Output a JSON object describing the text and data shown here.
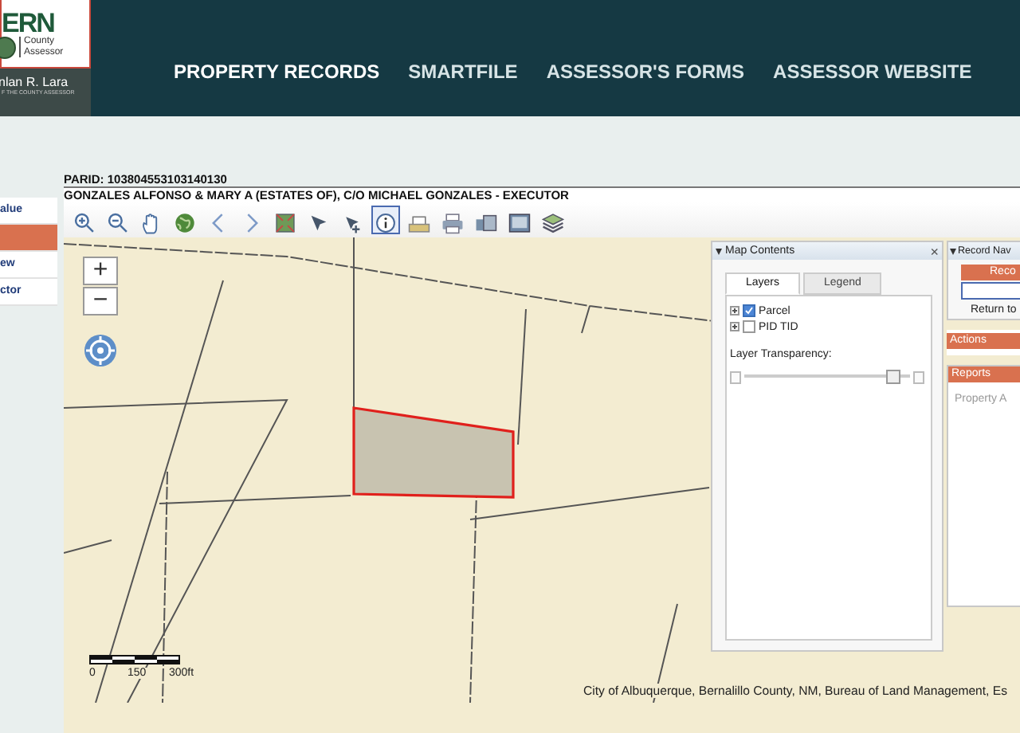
{
  "header": {
    "logo": {
      "wordmark": "ERN",
      "line_1": "County",
      "line_2": "Assessor",
      "name": "nlan R. Lara",
      "subtitle": "F THE COUNTY ASSESSOR"
    },
    "nav": [
      {
        "label": "PROPERTY RECORDS",
        "selected": true
      },
      {
        "label": "SMARTFILE",
        "selected": false
      },
      {
        "label": "ASSESSOR'S FORMS",
        "selected": false
      },
      {
        "label": "ASSESSOR WEBSITE",
        "selected": false
      }
    ]
  },
  "sidebar": {
    "items": [
      {
        "label": "alue",
        "selected": false
      },
      {
        "selected": true
      },
      {
        "label": "ew",
        "selected": false
      },
      {
        "label": "ctor",
        "selected": false
      }
    ]
  },
  "record": {
    "parid": "PARID: 103804553103140130",
    "owner": "GONZALES ALFONSO & MARY A (ESTATES OF), C/O MICHAEL GONZALES - EXECUTOR"
  },
  "toolbar": [
    {
      "kind": "zoom-in",
      "selected": false
    },
    {
      "kind": "zoom-out",
      "selected": false
    },
    {
      "kind": "pan",
      "selected": false
    },
    {
      "kind": "globe",
      "selected": false
    },
    {
      "kind": "back",
      "selected": false
    },
    {
      "kind": "forward",
      "selected": false
    },
    {
      "kind": "extent",
      "selected": false
    },
    {
      "kind": "select",
      "selected": false
    },
    {
      "kind": "select-plus",
      "selected": false
    },
    {
      "kind": "info",
      "selected": true
    },
    {
      "kind": "measure",
      "selected": false
    },
    {
      "kind": "print",
      "selected": false
    },
    {
      "kind": "export",
      "selected": false
    },
    {
      "kind": "image",
      "selected": false
    },
    {
      "kind": "layers",
      "selected": false
    }
  ],
  "map": {
    "zoom_in": "+",
    "zoom_out": "−",
    "scale_labels": [
      "0",
      "150",
      "300ft"
    ],
    "attribution": "City of Albuquerque, Bernalillo County, NM, Bureau of Land Management, Es",
    "contents": {
      "title": "Map Contents",
      "close": "×",
      "tabs": [
        {
          "label": "Layers",
          "selected": true
        },
        {
          "label": "Legend",
          "selected": false
        }
      ],
      "layers": [
        {
          "label": "Parcel",
          "checked": true
        },
        {
          "label": "PID TID",
          "checked": false
        }
      ],
      "transparency": {
        "label": "Layer Transparency:",
        "level": 0.93
      }
    },
    "record_nav": {
      "title": "Record Nav",
      "record_button": "Reco",
      "return_label": "Return to",
      "actions": "Actions",
      "reports": "Reports",
      "report_item": "Property A"
    }
  }
}
